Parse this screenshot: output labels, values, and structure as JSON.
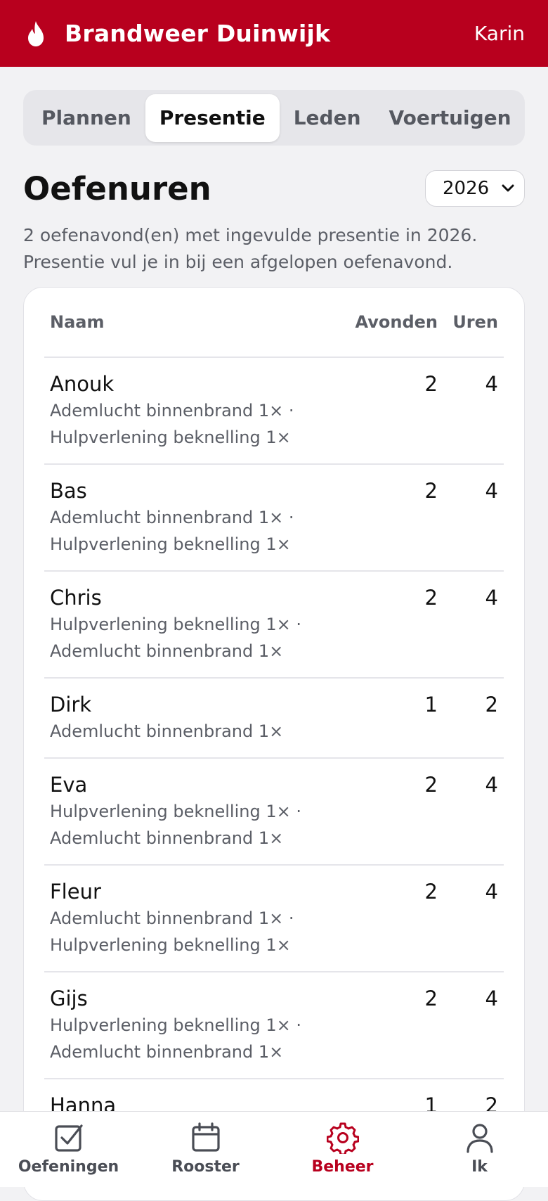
{
  "header": {
    "title": "Brandweer Duinwijk",
    "user": "Karin",
    "icon": "flame-icon"
  },
  "tabs": [
    {
      "label": "Plannen",
      "active": false
    },
    {
      "label": "Presentie",
      "active": true
    },
    {
      "label": "Leden",
      "active": false
    },
    {
      "label": "Voertuigen",
      "active": false
    }
  ],
  "page": {
    "title": "Oefenuren",
    "year": "2026",
    "intro_line1": "2 oefenavond(en) met ingevulde presentie in 2026.",
    "intro_line2": "Presentie vul je in bij een afgelopen oefenavond."
  },
  "table": {
    "headers": {
      "name": "Naam",
      "avonden": "Avonden",
      "uren": "Uren"
    },
    "rows": [
      {
        "name": "Anouk",
        "line1": "Ademlucht binnenbrand 1× ·",
        "line2": "Hulpverlening beknelling 1×",
        "avonden": "2",
        "uren": "4"
      },
      {
        "name": "Bas",
        "line1": "Ademlucht binnenbrand 1× ·",
        "line2": "Hulpverlening beknelling 1×",
        "avonden": "2",
        "uren": "4"
      },
      {
        "name": "Chris",
        "line1": "Hulpverlening beknelling 1× ·",
        "line2": "Ademlucht binnenbrand 1×",
        "avonden": "2",
        "uren": "4"
      },
      {
        "name": "Dirk",
        "line1": "Ademlucht binnenbrand 1×",
        "line2": "",
        "avonden": "1",
        "uren": "2"
      },
      {
        "name": "Eva",
        "line1": "Hulpverlening beknelling 1× ·",
        "line2": "Ademlucht binnenbrand 1×",
        "avonden": "2",
        "uren": "4"
      },
      {
        "name": "Fleur",
        "line1": "Ademlucht binnenbrand 1× ·",
        "line2": "Hulpverlening beknelling 1×",
        "avonden": "2",
        "uren": "4"
      },
      {
        "name": "Gijs",
        "line1": "Hulpverlening beknelling 1× ·",
        "line2": "Ademlucht binnenbrand 1×",
        "avonden": "2",
        "uren": "4"
      },
      {
        "name": "Hanna",
        "line1": "",
        "line2": "",
        "avonden": "1",
        "uren": "2"
      }
    ]
  },
  "bottom_nav": [
    {
      "label": "Oefeningen",
      "icon": "checkbox-icon",
      "active": false
    },
    {
      "label": "Rooster",
      "icon": "calendar-icon",
      "active": false
    },
    {
      "label": "Beheer",
      "icon": "gear-icon",
      "active": true
    },
    {
      "label": "Ik",
      "icon": "person-icon",
      "active": false
    }
  ],
  "colors": {
    "brand": "#b8001e",
    "background": "#f2f2f4"
  }
}
